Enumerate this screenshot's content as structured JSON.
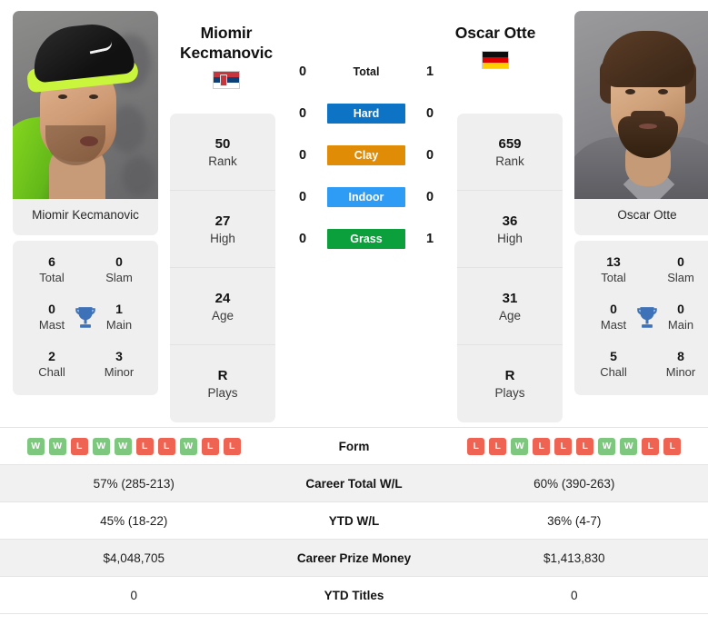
{
  "players": {
    "left": {
      "display_name_line1": "Miomir",
      "display_name_line2": "Kecmanovic",
      "photo_caption": "Miomir Kecmanovic",
      "country_flag": "serbia-flag",
      "stats": [
        {
          "value": "50",
          "label": "Rank"
        },
        {
          "value": "27",
          "label": "High"
        },
        {
          "value": "24",
          "label": "Age"
        },
        {
          "value": "R",
          "label": "Plays"
        }
      ],
      "titles": [
        {
          "value": "6",
          "label": "Total"
        },
        {
          "value": "0",
          "label": "Slam"
        },
        {
          "value": "0",
          "label": "Mast"
        },
        {
          "value": "1",
          "label": "Main"
        },
        {
          "value": "2",
          "label": "Chall"
        },
        {
          "value": "3",
          "label": "Minor"
        }
      ],
      "form": [
        "W",
        "W",
        "L",
        "W",
        "W",
        "L",
        "L",
        "W",
        "L",
        "L"
      ],
      "career_total_wl": "57% (285-213)",
      "ytd_wl": "45% (18-22)",
      "career_prize_money": "$4,048,705",
      "ytd_titles": "0"
    },
    "right": {
      "display_name_line1": "Oscar Otte",
      "display_name_line2": "",
      "photo_caption": "Oscar Otte",
      "country_flag": "germany-flag",
      "stats": [
        {
          "value": "659",
          "label": "Rank"
        },
        {
          "value": "36",
          "label": "High"
        },
        {
          "value": "31",
          "label": "Age"
        },
        {
          "value": "R",
          "label": "Plays"
        }
      ],
      "titles": [
        {
          "value": "13",
          "label": "Total"
        },
        {
          "value": "0",
          "label": "Slam"
        },
        {
          "value": "0",
          "label": "Mast"
        },
        {
          "value": "0",
          "label": "Main"
        },
        {
          "value": "5",
          "label": "Chall"
        },
        {
          "value": "8",
          "label": "Minor"
        }
      ],
      "form": [
        "L",
        "L",
        "W",
        "L",
        "L",
        "L",
        "W",
        "W",
        "L",
        "L"
      ],
      "career_total_wl": "60% (390-263)",
      "ytd_wl": "36% (4-7)",
      "career_prize_money": "$1,413,830",
      "ytd_titles": "0"
    }
  },
  "head_to_head": [
    {
      "surface": "Total",
      "left": "0",
      "right": "1",
      "color": "transparent",
      "text_color": "#141414"
    },
    {
      "surface": "Hard",
      "left": "0",
      "right": "0",
      "color": "#0d73c4",
      "text_color": "#ffffff"
    },
    {
      "surface": "Clay",
      "left": "0",
      "right": "0",
      "color": "#e08c06",
      "text_color": "#ffffff"
    },
    {
      "surface": "Indoor",
      "left": "0",
      "right": "0",
      "color": "#2e9bf5",
      "text_color": "#ffffff"
    },
    {
      "surface": "Grass",
      "left": "0",
      "right": "1",
      "color": "#0ca03c",
      "text_color": "#ffffff"
    }
  ],
  "table_rows": [
    {
      "label": "Form",
      "type": "form",
      "shaded": false
    },
    {
      "label": "Career Total W/L",
      "type": "text",
      "shaded": true,
      "left": "57% (285-213)",
      "right": "60% (390-263)"
    },
    {
      "label": "YTD W/L",
      "type": "text",
      "shaded": false,
      "left": "45% (18-22)",
      "right": "36% (4-7)"
    },
    {
      "label": "Career Prize Money",
      "type": "text",
      "shaded": true,
      "left": "$4,048,705",
      "right": "$1,413,830"
    },
    {
      "label": "YTD Titles",
      "type": "text",
      "shaded": false,
      "left": "0",
      "right": "0"
    }
  ],
  "colors": {
    "hard": "#0d73c4",
    "clay": "#e08c06",
    "indoor": "#2e9bf5",
    "grass": "#0ca03c",
    "win_badge": "#7ec77e",
    "loss_badge": "#ee6352",
    "panel": "#efefef",
    "row_shade": "#f1f1f1",
    "trophy": "#3d72b8"
  }
}
